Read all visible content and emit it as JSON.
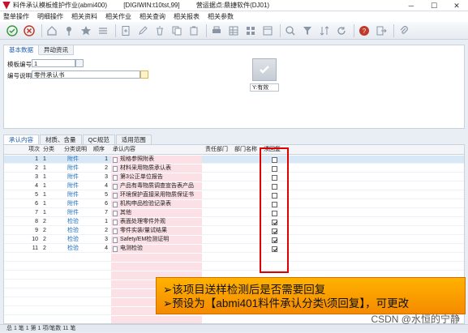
{
  "window": {
    "title": "料件承认模板维护作业(abmi400)",
    "db": "[DIGIWIN:t10tst,99]",
    "company": "营运据点:鼎捷软件(DJ01)",
    "minimize": "─",
    "maximize": "☐",
    "close": "✕"
  },
  "menu": [
    "整单操作",
    "明细操作",
    "相关资料",
    "相关作业",
    "相关查询",
    "相关报表",
    "相关参数"
  ],
  "header": {
    "tabs": [
      "基本数据",
      "异动资讯"
    ],
    "template_no_label": "模板编号",
    "template_no_value": "1",
    "desc_label": "编号说明",
    "desc_value": "零件承认书",
    "valid_label": "Y:有效"
  },
  "body_tabs": [
    "承认内容",
    "材质、含量",
    "QC规范",
    "适用范围"
  ],
  "grid": {
    "columns": [
      "项次",
      "分类",
      "分类说明",
      "顺序",
      "承认内容",
      "责任部门",
      "部门名称",
      "须回复"
    ],
    "rows": [
      {
        "seq": "1",
        "cat": "1",
        "cat_desc": "附件",
        "order": "1",
        "content": "规格参照附表",
        "reply": false
      },
      {
        "seq": "2",
        "cat": "1",
        "cat_desc": "附件",
        "order": "2",
        "content": "材料采用物质承认表",
        "reply": false
      },
      {
        "seq": "3",
        "cat": "1",
        "cat_desc": "附件",
        "order": "3",
        "content": "第3公正单位报告",
        "reply": false
      },
      {
        "seq": "4",
        "cat": "1",
        "cat_desc": "附件",
        "order": "4",
        "content": "产品有毒物质调查宣告表产品",
        "reply": false
      },
      {
        "seq": "5",
        "cat": "1",
        "cat_desc": "附件",
        "order": "5",
        "content": "环境保护直接采用物质保证书",
        "reply": false
      },
      {
        "seq": "6",
        "cat": "1",
        "cat_desc": "附件",
        "order": "6",
        "content": "机构申品检验记录表",
        "reply": false
      },
      {
        "seq": "7",
        "cat": "1",
        "cat_desc": "附件",
        "order": "7",
        "content": "其他",
        "reply": false
      },
      {
        "seq": "8",
        "cat": "2",
        "cat_desc": "检验",
        "order": "1",
        "content": "表面处理零件外观",
        "reply": true
      },
      {
        "seq": "9",
        "cat": "2",
        "cat_desc": "检验",
        "order": "2",
        "content": "零件实装/量试结果",
        "reply": true
      },
      {
        "seq": "10",
        "cat": "2",
        "cat_desc": "检验",
        "order": "3",
        "content": "Safety/EM检测证明",
        "reply": true
      },
      {
        "seq": "11",
        "cat": "2",
        "cat_desc": "检验",
        "order": "4",
        "content": "电测检验",
        "reply": true
      }
    ]
  },
  "callout": {
    "line1": "➢该项目送样检测后是否需要回复",
    "line2": "➢预设为【abmi401料件承认分类\\须回复】，可更改"
  },
  "watermark": "CSDN @水恒的宁静",
  "status": "总    1 笔   1 第   1 项/笔数   11 笔",
  "colors": {
    "accent": "#f58a00",
    "highlight": "#e00000",
    "link": "#1a6fc0"
  }
}
